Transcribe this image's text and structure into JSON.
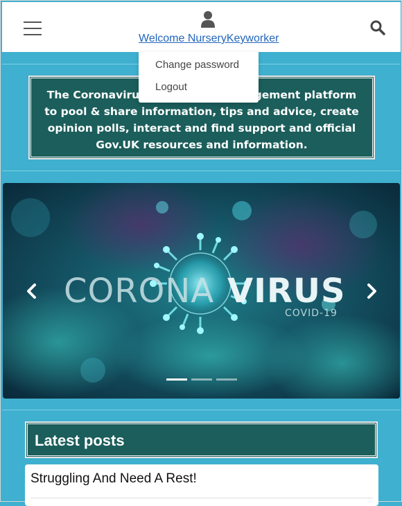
{
  "header": {
    "welcome_link": "Welcome NurseryKeyworker"
  },
  "dropdown": {
    "items": [
      "Change password",
      "Logout"
    ]
  },
  "info_box": {
    "text": "The Coronavirus Forum is an engagement platform to pool & share information, tips and advice, create opinion polls, interact and find support and official Gov.UK resources and information."
  },
  "carousel": {
    "slide_word_light": "CORONA",
    "slide_word_bold": "VIRUS",
    "slide_subtitle": "COVID-19",
    "active_index": 0,
    "slide_count": 3
  },
  "latest_posts": {
    "title": "Latest posts",
    "posts": [
      {
        "title": "Struggling And Need A Rest!"
      }
    ]
  },
  "colors": {
    "page_bg": "#3fb0cf",
    "panel_teal": "#1b5e5b",
    "link_blue": "#2266bb"
  },
  "icons": [
    "hamburger-menu-icon",
    "user-icon",
    "search-icon",
    "chevron-left-icon",
    "chevron-right-icon"
  ]
}
